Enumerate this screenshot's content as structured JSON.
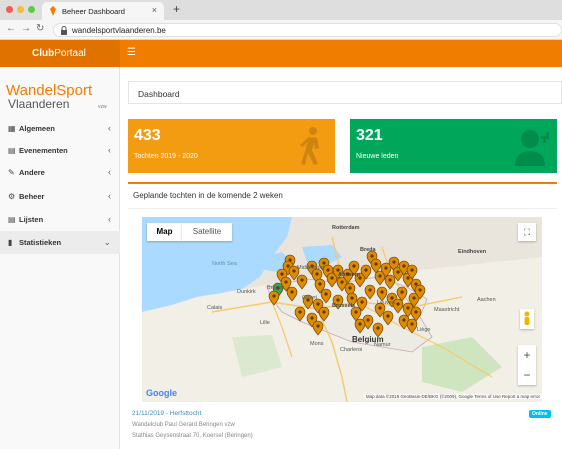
{
  "browser": {
    "tab_title": "Beheer Dashboard",
    "url": "wandelsportvlaanderen.be",
    "new_tab": "+"
  },
  "header": {
    "logo_bold": "Club",
    "logo_rest": "Portaal",
    "menu_icon": "☰"
  },
  "brand": {
    "line1": "WandelSport",
    "line2": "Vlaanderen",
    "suffix": "vzw"
  },
  "sidebar": {
    "items": [
      {
        "label": "Algemeen",
        "icon": "grid-icon",
        "glyph": "▦",
        "chevron": "‹"
      },
      {
        "label": "Evenementen",
        "icon": "calendar-icon",
        "glyph": "▤",
        "chevron": "‹"
      },
      {
        "label": "Andere",
        "icon": "edit-icon",
        "glyph": "✎",
        "chevron": "‹"
      },
      {
        "label": "Beheer",
        "icon": "cogs-icon",
        "glyph": "⚙",
        "chevron": "‹"
      },
      {
        "label": "Lijsten",
        "icon": "list-icon",
        "glyph": "▤",
        "chevron": "‹"
      },
      {
        "label": "Statistieken",
        "icon": "bar-chart-icon",
        "glyph": "▮",
        "chevron": "⌄"
      }
    ]
  },
  "page": {
    "title": "Dashboard"
  },
  "stats": [
    {
      "value": "433",
      "label": "Tochten 2019 - 2020",
      "color": "#f39c12",
      "icon": "walker-icon"
    },
    {
      "value": "321",
      "label": "Nieuwe leden",
      "color": "#00a65a",
      "icon": "user-icon"
    }
  ],
  "panel": {
    "title": "Geplande tochten in de komende 2 weken"
  },
  "map": {
    "type_map": "Map",
    "type_satellite": "Satellite",
    "fullscreen": "⛶",
    "zoom_in": "+",
    "zoom_out": "−",
    "google": "Google",
    "attribution": "Map data ©2019 GeoBasis-DE/BKG (©2009), Google   Terms of Use   Report a map error",
    "labels": [
      "Rotterdam",
      "Breda",
      "Eindhoven",
      "Middelburg",
      "Antwerp",
      "Bruges",
      "Ghent",
      "Brussels",
      "Leuven",
      "Maastricht",
      "Lille",
      "Charleroi",
      "Namur",
      "Liège",
      "Belgium",
      "North Sea",
      "Dunkirk",
      "Calais",
      "Mons",
      "Aachen"
    ]
  },
  "event": {
    "title": "21/11/2019 - Herfsttocht",
    "badge": "Online",
    "organizer": "Wandelclub Paul Gerard Beringen vzw",
    "address": "Stathias Geysenstraat 70, Koersel (Beringen)"
  }
}
